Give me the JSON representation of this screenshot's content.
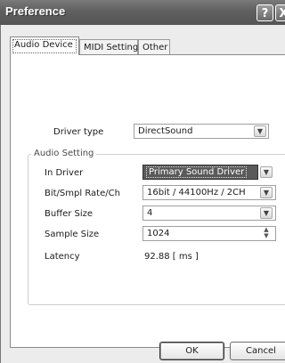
{
  "window": {
    "title": "Preference",
    "help_glyph": "?",
    "close_glyph": "X"
  },
  "tabs": [
    {
      "label": "Audio Device",
      "active": true
    },
    {
      "label": "MIDI Setting",
      "active": false
    },
    {
      "label": "Other",
      "active": false
    }
  ],
  "audio_device": {
    "driver_type_label": "Driver type",
    "driver_type_value": "DirectSound",
    "group_title": "Audio Setting",
    "in_driver_label": "In Driver",
    "in_driver_value": "Primary Sound Driver",
    "rate_label": "Bit/Smpl Rate/Ch",
    "rate_value": "16bit / 44100Hz / 2CH",
    "buffer_label": "Buffer Size",
    "buffer_value": "4",
    "sample_label": "Sample Size",
    "sample_value": "1024",
    "latency_label": "Latency",
    "latency_value": "92.88 [ ms ]"
  },
  "buttons": {
    "ok": "OK",
    "cancel": "Cancel"
  },
  "icons": {
    "dropdown": "chevron-down-icon",
    "spin": "spin-arrows-icon"
  }
}
